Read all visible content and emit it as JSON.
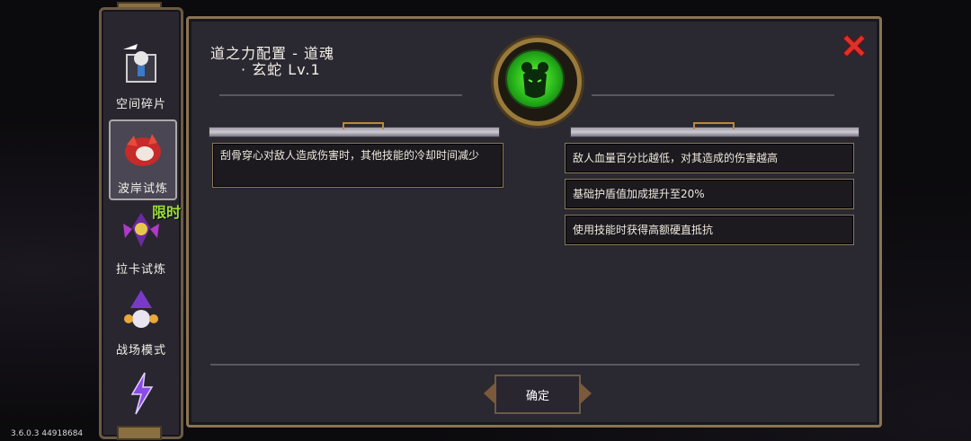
{
  "sidebar": {
    "items": [
      {
        "label": "空间碎片",
        "icon": "space-fragment-icon"
      },
      {
        "label": "波岸试炼",
        "icon": "wave-shore-trial-icon",
        "active": true
      },
      {
        "label": "拉卡试炼",
        "icon": "laka-trial-icon",
        "badge": "限时"
      },
      {
        "label": "战场模式",
        "icon": "battlefield-mode-icon"
      },
      {
        "label": "",
        "icon": "lightning-icon"
      }
    ]
  },
  "dialog": {
    "title_line1": "道之力配置 - 道魂",
    "title_line2": "· 玄蛇 Lv.1",
    "left_effect": "刮骨穿心对敌人造成伤害时，其他技能的冷却时间减少",
    "right_effects": [
      "敌人血量百分比越低，对其造成的伤害越高",
      "基础护盾值加成提升至20%",
      "使用技能时获得高额硬直抵抗"
    ],
    "confirm_label": "确定"
  },
  "version": "3.6.0.3 44918684",
  "colors": {
    "accent": "#8a7452",
    "close": "#e0302a",
    "emblem": "#3ad12a"
  }
}
